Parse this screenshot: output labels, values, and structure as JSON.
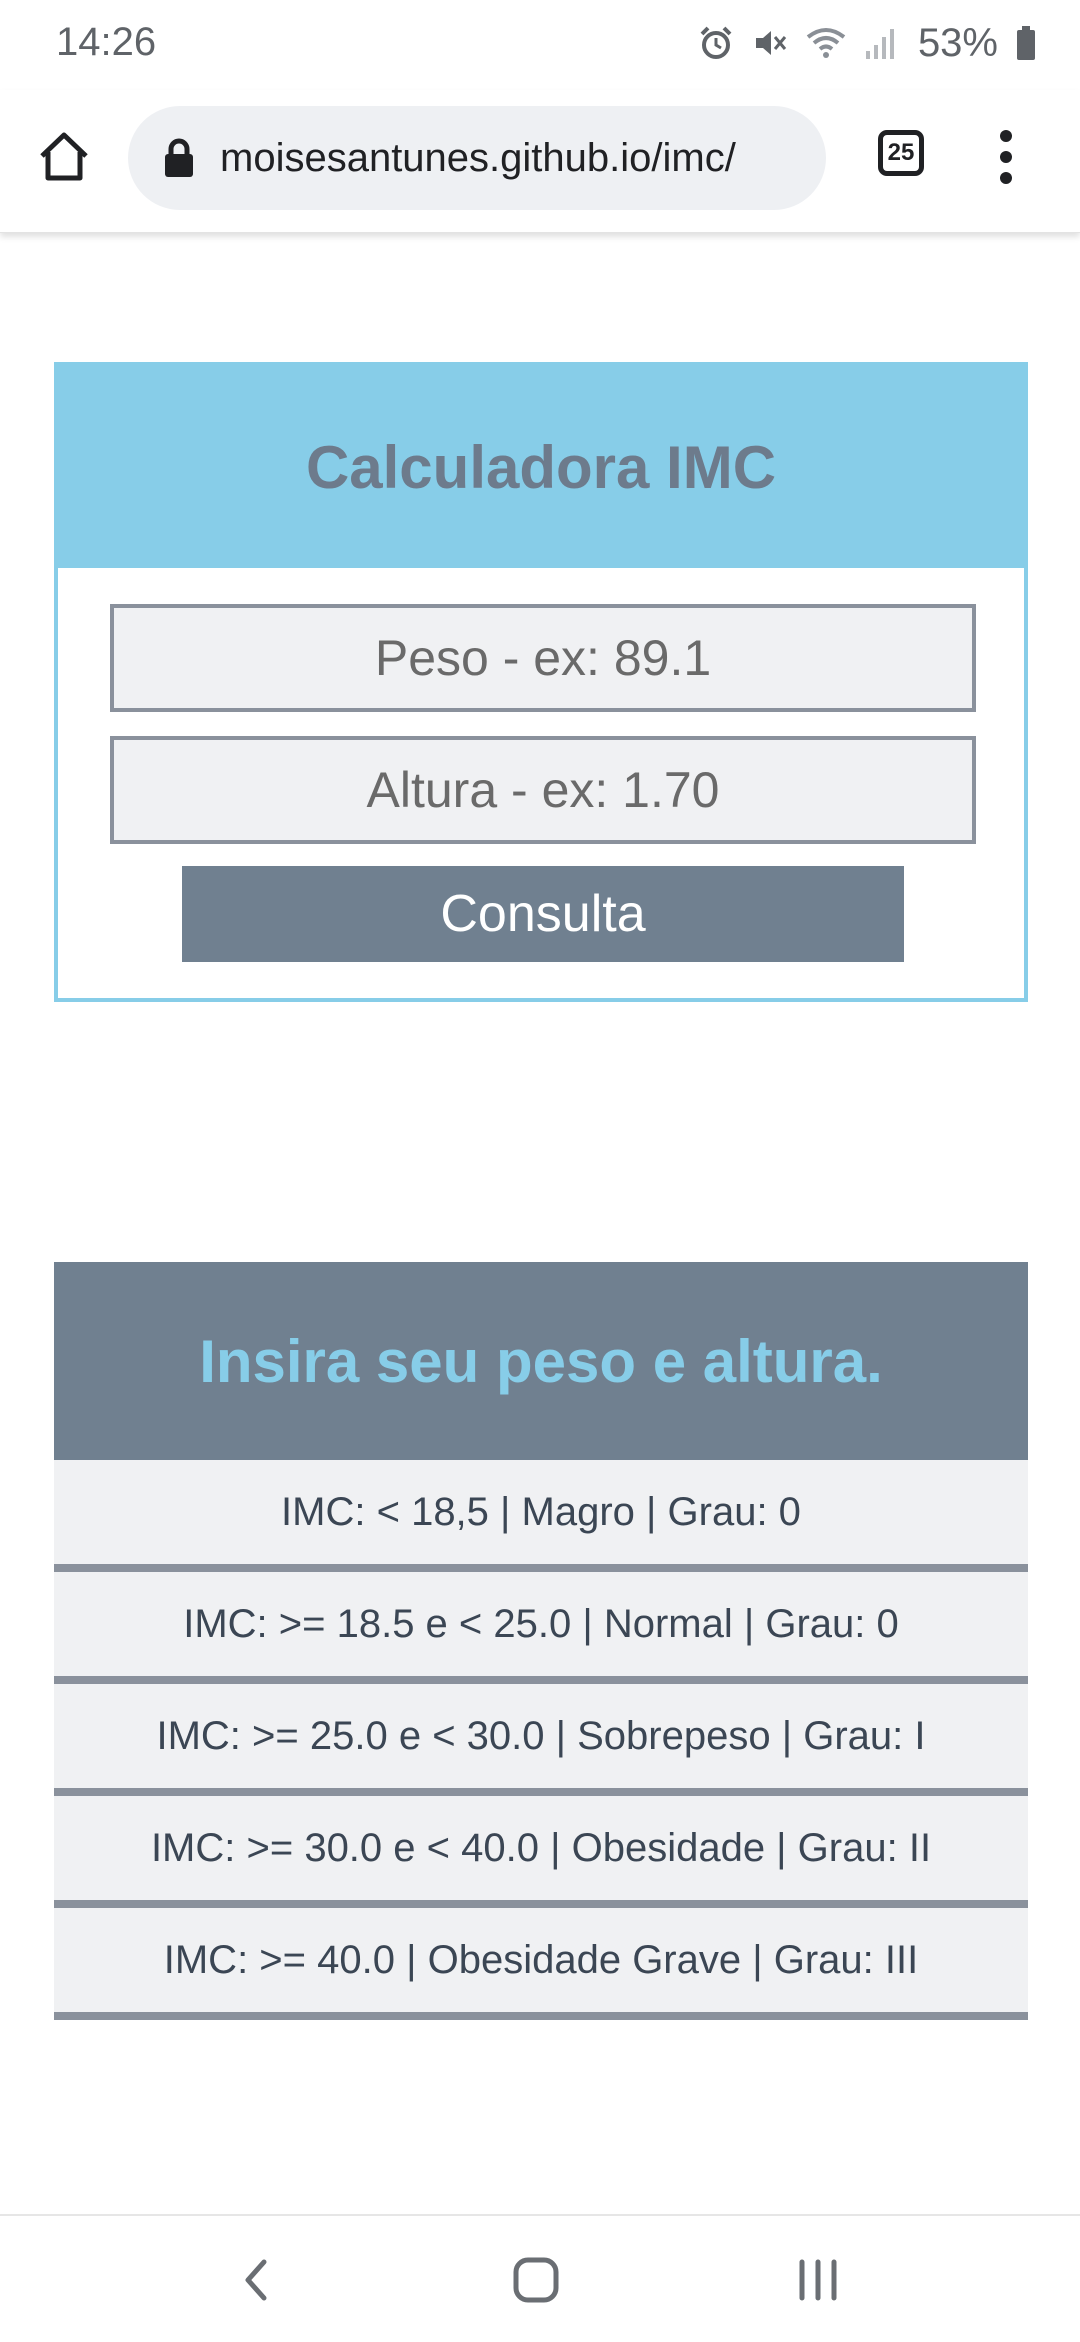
{
  "status_bar": {
    "time": "14:26",
    "battery": "53%",
    "icons": [
      "alarm-icon",
      "mute-icon",
      "wifi-icon",
      "signal-icon",
      "battery-icon"
    ]
  },
  "browser": {
    "url": "moisesantunes.github.io/imc/",
    "tab_count": "25",
    "icons": [
      "home-icon",
      "lock-icon",
      "tabs-icon",
      "more-menu-icon"
    ]
  },
  "calculator": {
    "title": "Calculadora IMC",
    "weight_placeholder": "Peso - ex: 89.1",
    "weight_value": "",
    "height_placeholder": "Altura - ex: 1.70",
    "height_value": "",
    "button_label": "Consulta"
  },
  "result": {
    "title": "Insira seu peso e altura.",
    "rows": [
      "IMC: < 18,5 | Magro | Grau: 0",
      "IMC: >= 18.5 e < 25.0 | Normal | Grau: 0",
      "IMC: >= 25.0 e < 30.0 | Sobrepeso | Grau: I",
      "IMC: >= 30.0 e < 40.0 | Obesidade | Grau: II",
      "IMC: >= 40.0 | Obesidade Grave | Grau: III"
    ]
  },
  "nav_bar": {
    "icons": [
      "back-icon",
      "home-nav-icon",
      "recents-icon"
    ]
  },
  "colors": {
    "accent_light_blue": "#87cde8",
    "slate_gray": "#708090",
    "input_background": "#f0f1f3",
    "border_gray": "#8a919c"
  }
}
